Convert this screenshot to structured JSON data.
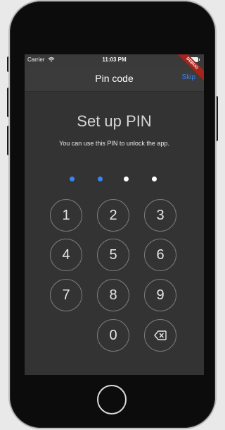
{
  "status_bar": {
    "carrier": "Carrier",
    "time": "11:03 PM"
  },
  "app_bar": {
    "title": "Pin code",
    "skip_label": "Skip"
  },
  "debug_banner": "DEBUG",
  "pin": {
    "title": "Set up PIN",
    "subtitle": "You can use this PIN to unlock the app.",
    "entered_digits": 2,
    "total_digits": 4
  },
  "keypad": {
    "keys": [
      "1",
      "2",
      "3",
      "4",
      "5",
      "6",
      "7",
      "8",
      "9",
      "0"
    ],
    "backspace_icon": "backspace-icon"
  },
  "colors": {
    "accent": "#3b82f6",
    "dot_filled": "#3b82f6",
    "dot_empty": "#ffffff",
    "screen_bg": "#333333",
    "debug_banner": "#a6221c"
  }
}
